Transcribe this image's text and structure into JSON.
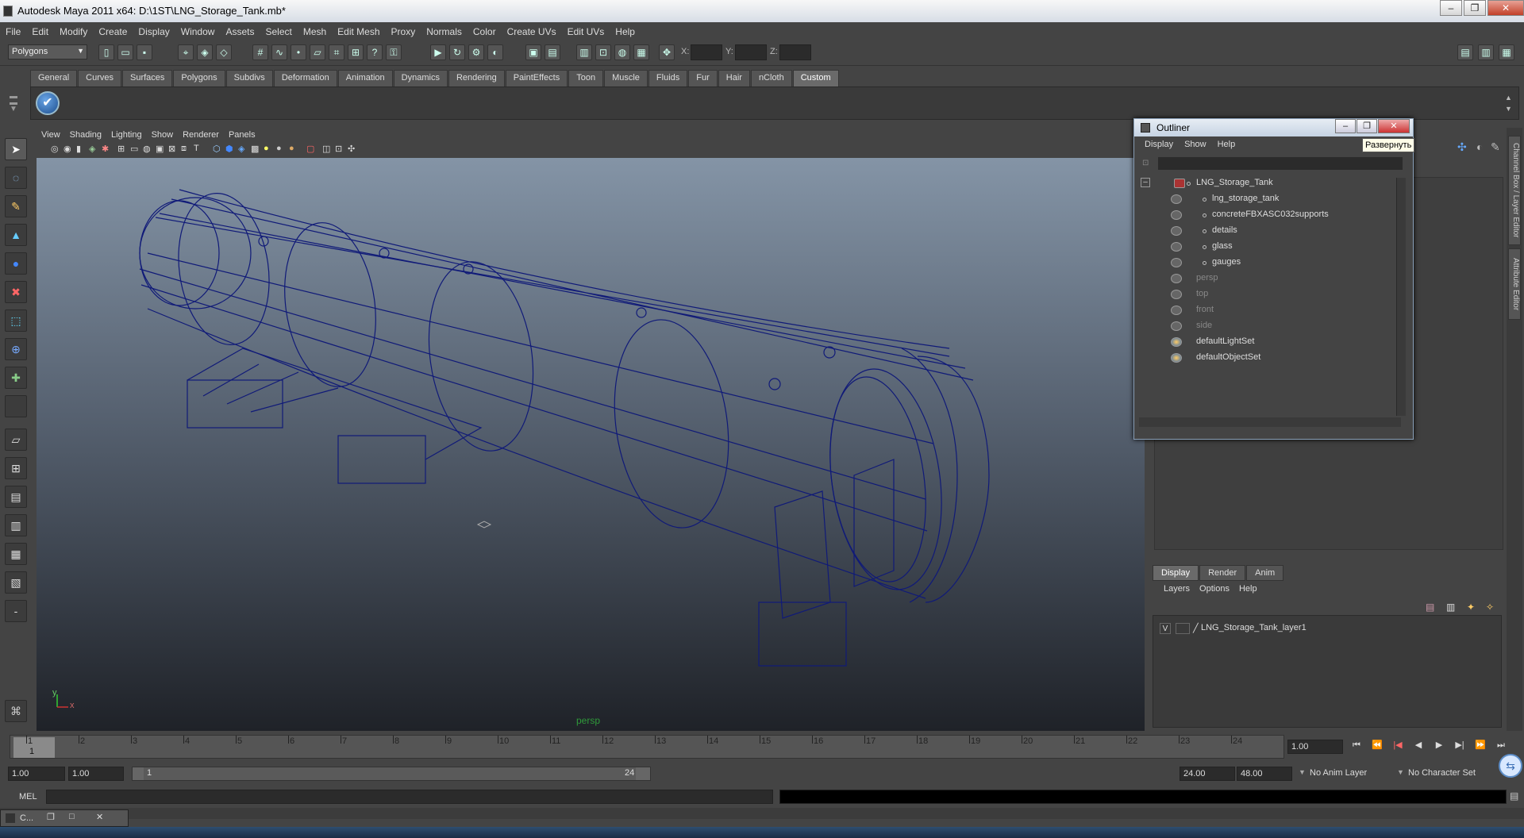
{
  "window": {
    "title": "Autodesk Maya 2011 x64: D:\\1ST\\LNG_Storage_Tank.mb*",
    "min": "–",
    "max": "❐",
    "close": "✕"
  },
  "menubar": [
    "File",
    "Edit",
    "Modify",
    "Create",
    "Display",
    "Window",
    "Assets",
    "Select",
    "Mesh",
    "Edit Mesh",
    "Proxy",
    "Normals",
    "Color",
    "Create UVs",
    "Edit UVs",
    "Help"
  ],
  "statusline": {
    "mode": "Polygons",
    "x_label": "X:",
    "y_label": "Y:",
    "z_label": "Z:"
  },
  "shelf": {
    "tabs": [
      "General",
      "Curves",
      "Surfaces",
      "Polygons",
      "Subdivs",
      "Deformation",
      "Animation",
      "Dynamics",
      "Rendering",
      "PaintEffects",
      "Toon",
      "Muscle",
      "Fluids",
      "Fur",
      "Hair",
      "nCloth",
      "Custom"
    ],
    "active_tab": "Custom"
  },
  "viewport": {
    "menu": [
      "View",
      "Shading",
      "Lighting",
      "Show",
      "Renderer",
      "Panels"
    ],
    "camera": "persp",
    "axis_x": "x",
    "axis_y": "y"
  },
  "outliner": {
    "title": "Outliner",
    "tooltip": "Развернуть",
    "menu": [
      "Display",
      "Show",
      "Help"
    ],
    "items": [
      {
        "label": "LNG_Storage_Tank",
        "dim": false,
        "level": 0
      },
      {
        "label": "lng_storage_tank",
        "dim": false,
        "level": 1
      },
      {
        "label": "concreteFBXASC032supports",
        "dim": false,
        "level": 1
      },
      {
        "label": "details",
        "dim": false,
        "level": 1
      },
      {
        "label": "glass",
        "dim": false,
        "level": 1
      },
      {
        "label": "gauges",
        "dim": false,
        "level": 1
      },
      {
        "label": "persp",
        "dim": true,
        "level": 0
      },
      {
        "label": "top",
        "dim": true,
        "level": 0
      },
      {
        "label": "front",
        "dim": true,
        "level": 0
      },
      {
        "label": "side",
        "dim": true,
        "level": 0
      },
      {
        "label": "defaultLightSet",
        "dim": false,
        "level": 0
      },
      {
        "label": "defaultObjectSet",
        "dim": false,
        "level": 0
      }
    ]
  },
  "side_tabs": [
    "Channel Box / Layer Editor",
    "Attribute Editor"
  ],
  "layer_editor": {
    "tabs": [
      "Display",
      "Render",
      "Anim"
    ],
    "active_tab": "Display",
    "menu": [
      "Layers",
      "Options",
      "Help"
    ],
    "layers": [
      {
        "visible": "V",
        "name": "LNG_Storage_Tank_layer1"
      }
    ]
  },
  "timeline": {
    "ticks": [
      "1",
      "2",
      "3",
      "4",
      "5",
      "6",
      "7",
      "8",
      "9",
      "10",
      "11",
      "12",
      "13",
      "14",
      "15",
      "16",
      "17",
      "18",
      "19",
      "20",
      "21",
      "22",
      "23",
      "24"
    ],
    "current_frame": "1.00",
    "current_marker": "1"
  },
  "range": {
    "start": "1.00",
    "playback_start": "1.00",
    "slider_start": "1",
    "slider_end": "24",
    "playback_end": "24.00",
    "end": "48.00",
    "anim_layer": "No Anim Layer",
    "char_set": "No Character Set"
  },
  "mel": {
    "label": "MEL"
  },
  "minimized_window": {
    "label": "C..."
  },
  "colors": {
    "wire": "#101a78",
    "accent": "#5c8dc8"
  }
}
